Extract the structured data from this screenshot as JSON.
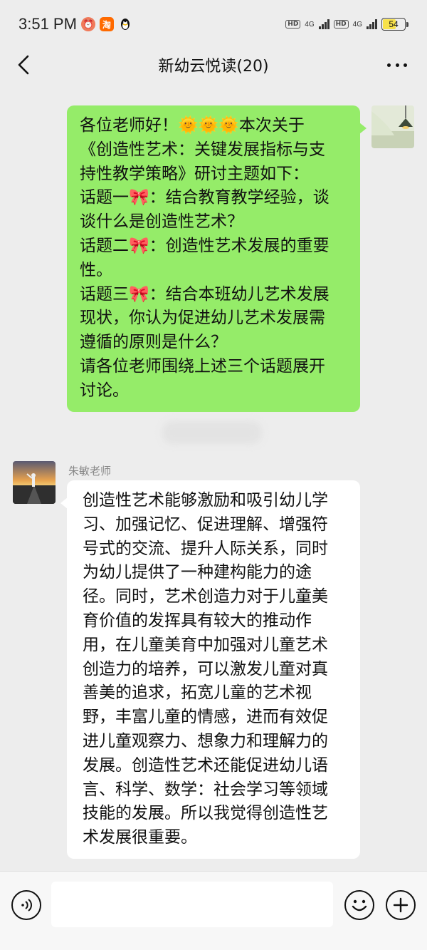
{
  "status_bar": {
    "time": "3:51 PM",
    "app_icons": [
      "alarm-clock-icon",
      "taobao-icon",
      "qq-penguin-icon"
    ],
    "taobao_label": "淘",
    "hd_label": "HD",
    "network_label": "4G",
    "battery_level": "54",
    "colors": {
      "battery_fill": "#f7e14a"
    }
  },
  "nav": {
    "title": "新幼云悦读(20)",
    "back_icon": "chevron-left-icon",
    "more_icon": "more-dots-icon"
  },
  "messages": [
    {
      "from": "self",
      "text": "各位老师好！🌞🌞🌞本次关于\n《创造性艺术：关键发展指标与支\n持性教学策略》研讨主题如下：\n话题一🎀：结合教育教学经验，谈\n谈什么是创造性艺术？\n话题二🎀：创造性艺术发展的重要\n性。\n话题三🎀：结合本班幼儿艺术发展\n现状，你认为促进幼儿艺术发展需\n遵循的原则是什么？\n请各位老师围绕上述三个话题展开\n讨论。"
    },
    {
      "from": "other",
      "sender": "朱敏老师",
      "text": "创造性艺术能够激励和吸引幼儿学\n习、加强记忆、促进理解、增强符\n号式的交流、提升人际关系，同时\n为幼儿提供了一种建构能力的途\n径。同时，艺术创造力对于儿童美\n育价值的发挥具有较大的推动作\n用，在儿童美育中加强对儿童艺术\n创造力的培养，可以激发儿童对真\n善美的追求，拓宽儿童的艺术视\n野，丰富儿童的情感，进而有效促\n进儿童观察力、想象力和理解力的\n发展。创造性艺术还能促进幼儿语\n言、科学、数学：社会学习等领域\n技能的发展。所以我觉得创造性艺\n术发展很重要。"
    }
  ],
  "colors": {
    "background": "#ededed",
    "self_bubble": "#95ec69",
    "other_bubble": "#ffffff"
  },
  "input_bar": {
    "voice_icon": "voice-icon",
    "emoji_icon": "emoji-icon",
    "plus_icon": "plus-icon",
    "value": ""
  }
}
